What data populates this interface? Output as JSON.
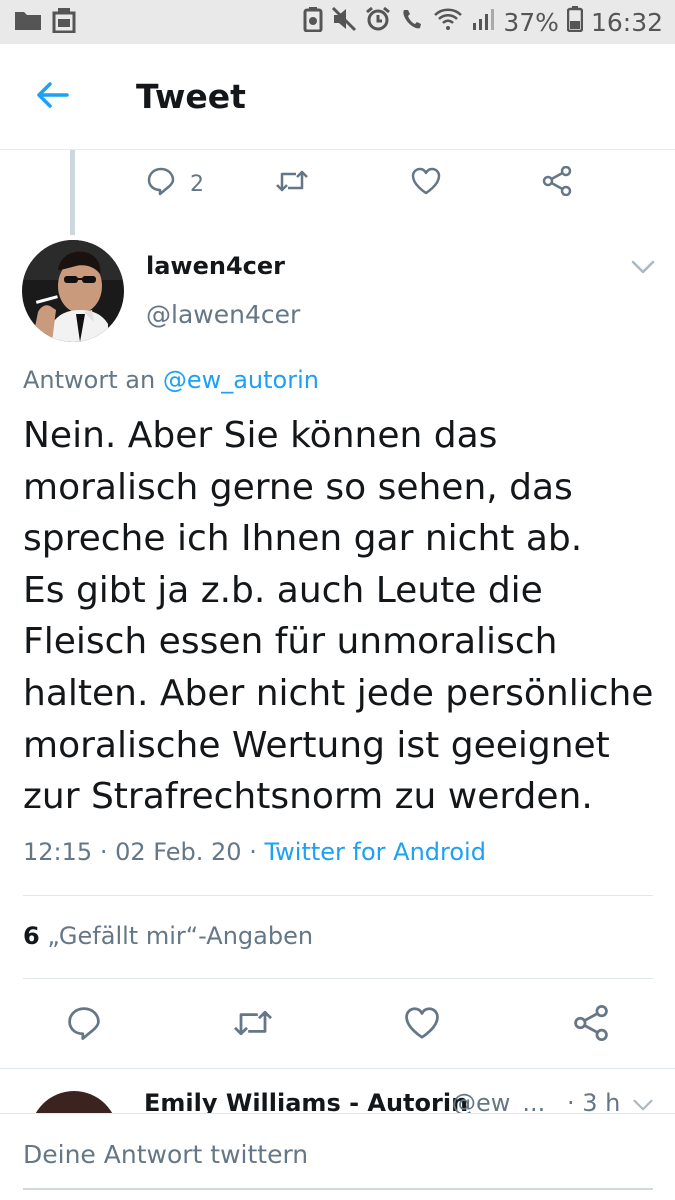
{
  "status_bar": {
    "battery": "37%",
    "time": "16:32"
  },
  "header": {
    "title": "Tweet"
  },
  "previous_tweet": {
    "reply_count": "2"
  },
  "tweet": {
    "display_name": "lawen4cer",
    "handle": "@lawen4cer",
    "reply_to_prefix": "Antwort an",
    "reply_to_mention": "@ew_autorin",
    "text": "Nein. Aber Sie können das\nmoralisch gerne so sehen, das\nspreche ich Ihnen gar nicht ab.\nEs gibt ja z.b. auch Leute die\nFleisch essen für unmoralisch\nhalten. Aber nicht jede persönliche\nmoralische Wertung ist geeignet\nzur Strafrechtsnorm zu werden.",
    "time": "12:15",
    "date": "02 Feb. 20",
    "source": "Twitter for Android",
    "like_count": "6",
    "like_label": "„Gefällt mir“-Angaben"
  },
  "next_reply": {
    "display_name": "Emily Williams - Autorin",
    "handle": "@ew_...",
    "time": "· 3 h"
  },
  "compose": {
    "placeholder": "Deine Antwort twittern"
  },
  "colors": {
    "accent": "#1da1f2",
    "secondary_text": "#657786",
    "status_bar_bg": "#e9e9e9"
  }
}
